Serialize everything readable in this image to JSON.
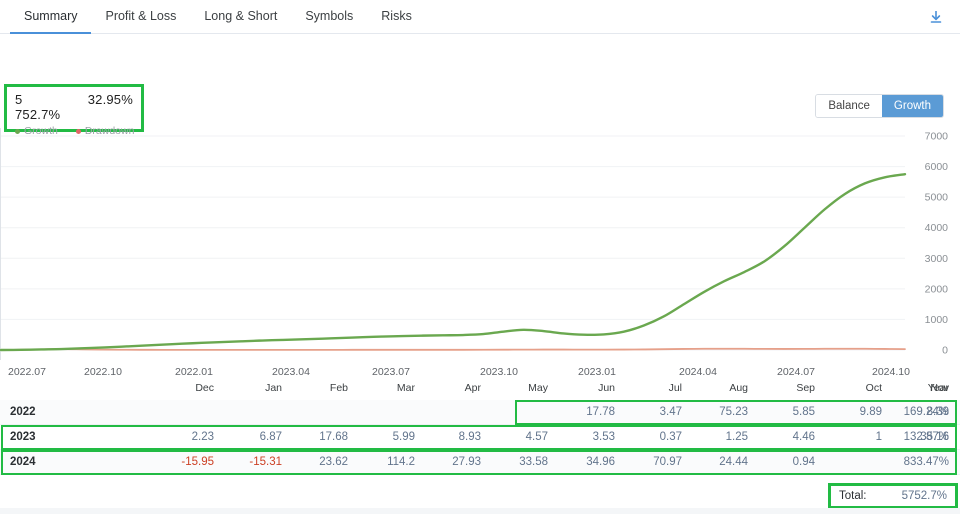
{
  "tabs": [
    {
      "label": "Summary",
      "active": true
    },
    {
      "label": "Profit & Loss",
      "active": false
    },
    {
      "label": "Long & Short",
      "active": false
    },
    {
      "label": "Symbols",
      "active": false
    },
    {
      "label": "Risks",
      "active": false
    }
  ],
  "download": {
    "icon": "download-icon"
  },
  "stats": {
    "growth_value": "5 752.7%",
    "growth_label": "Growth",
    "drawdown_value": "32.95%",
    "drawdown_label": "Drawdown",
    "growth_color": "#6aa84f",
    "drawdown_color": "#e06666",
    "highlight_color": "#22bb44"
  },
  "toggle": {
    "options": [
      "Balance",
      "Growth"
    ],
    "selected": "Growth",
    "active_color": "#5b9bd5"
  },
  "chart_data": {
    "type": "line",
    "title": "",
    "xlabel": "",
    "ylabel": "",
    "ylim": [
      0,
      7000
    ],
    "yticks": [
      0,
      1000,
      2000,
      3000,
      4000,
      5000,
      6000,
      7000
    ],
    "grid": true,
    "legend_position": "top-left",
    "x_tick_labels": [
      "2022.07",
      "2022.10",
      "2022.01",
      "2023.04",
      "2023.07",
      "2023.10",
      "2023.01",
      "2024.04",
      "2024.07",
      "2024.10"
    ],
    "series": [
      {
        "name": "Growth",
        "color": "#6aa84f",
        "values": [
          0,
          5,
          18,
          30,
          55,
          80,
          110,
          140,
          175,
          205,
          235,
          260,
          285,
          310,
          330,
          350,
          370,
          395,
          420,
          440,
          455,
          470,
          480,
          490,
          520,
          600,
          660,
          620,
          540,
          500,
          510,
          600,
          800,
          1100,
          1500,
          1900,
          2250,
          2550,
          2900,
          3400,
          4000,
          4600,
          5100,
          5450,
          5650,
          5752
        ]
      },
      {
        "name": "Drawdown",
        "color": "#e6a08a",
        "values": [
          0,
          8,
          20,
          28,
          22,
          12,
          8,
          6,
          5,
          5,
          4,
          4,
          4,
          4,
          5,
          5,
          5,
          5,
          6,
          6,
          6,
          6,
          6,
          7,
          8,
          10,
          12,
          14,
          14,
          12,
          12,
          14,
          18,
          26,
          34,
          40,
          42,
          40,
          36,
          34,
          36,
          40,
          42,
          40,
          34,
          28
        ]
      }
    ]
  },
  "table": {
    "month_headers": [
      "Dec",
      "Jan",
      "Feb",
      "Mar",
      "Apr",
      "May",
      "Jun",
      "Jul",
      "Aug",
      "Sep",
      "Oct",
      "Nov",
      "Year"
    ],
    "rows": [
      {
        "year": "2022",
        "cells": [
          "",
          "",
          "",
          "",
          "",
          "",
          "17.78",
          "3.47",
          "75.23",
          "5.85",
          "9.89",
          "8.39",
          "169.24%"
        ],
        "highlight": {
          "from_col": 6,
          "to_col": 12
        }
      },
      {
        "year": "2023",
        "cells": [
          "2.23",
          "6.87",
          "17.68",
          "5.99",
          "8.93",
          "4.57",
          "3.53",
          "0.37",
          "1.25",
          "4.46",
          "1",
          "35.16",
          "132.87%"
        ],
        "highlight": {
          "from_col": -1,
          "to_col": 12
        }
      },
      {
        "year": "2024",
        "cells": [
          "-15.95",
          "-15.31",
          "23.62",
          "114.2",
          "27.93",
          "33.58",
          "34.96",
          "70.97",
          "24.44",
          "0.94",
          "",
          "",
          "833.47%"
        ],
        "highlight": {
          "from_col": -1,
          "to_col": 12
        }
      }
    ],
    "total_label": "Total:",
    "total_value": "5752.7%"
  }
}
